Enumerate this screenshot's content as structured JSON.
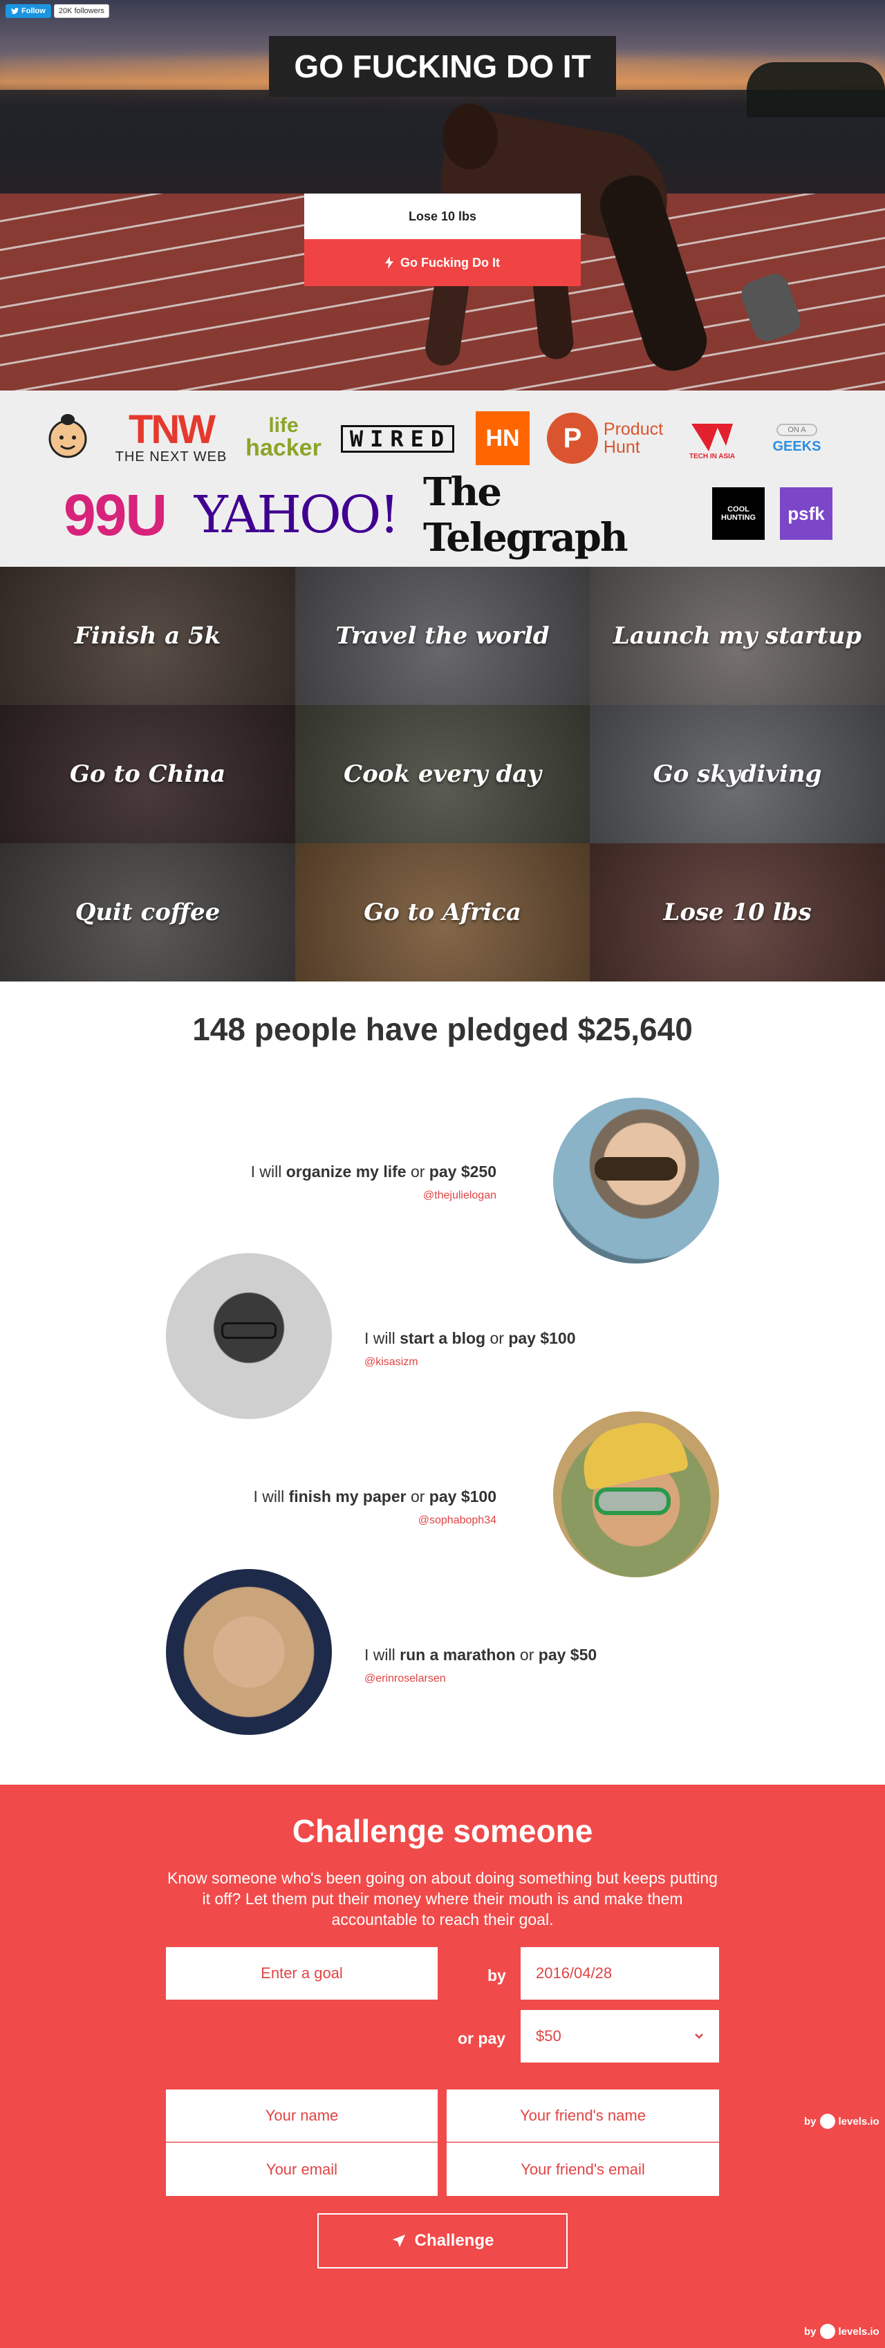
{
  "twitter": {
    "follow_label": "Follow",
    "followers": "20K followers"
  },
  "hero": {
    "title": "GO FUCKING DO IT",
    "goal": "Lose 10 lbs",
    "button": "Go Fucking Do It"
  },
  "press": {
    "tnw": "TNW",
    "tnw_sub": "THE NEXT WEB",
    "lifehacker_1": "life",
    "lifehacker_2": "hacker",
    "wired": "WIRED",
    "hn": "HN",
    "producthunt_p": "P",
    "producthunt_1": "Product",
    "producthunt_2": "Hunt",
    "techinasia": "TECH IN ASIA",
    "geeks_1": "GEEKS",
    "geeks_2": "ON A",
    "u99": "99U",
    "yahoo": "YAHOO!",
    "telegraph": "The Telegraph",
    "coolhunting": "COOL HUNTING",
    "psfk": "psfk"
  },
  "goals": [
    {
      "label": "Finish a 5k",
      "color": "#4a3d36"
    },
    {
      "label": "Travel the world",
      "color": "#5b5a5e"
    },
    {
      "label": "Launch my startup",
      "color": "#6a6562"
    },
    {
      "label": "Go to China",
      "color": "#3a2a2c"
    },
    {
      "label": "Cook every day",
      "color": "#4c4d42"
    },
    {
      "label": "Go skydiving",
      "color": "#5f6165"
    },
    {
      "label": "Quit coffee",
      "color": "#4c4a48"
    },
    {
      "label": "Go to Africa",
      "color": "#7a5a3a"
    },
    {
      "label": "Lose 10 lbs",
      "color": "#5a3a35"
    }
  ],
  "pledges": {
    "title": "148 people have pledged $25,640",
    "items": [
      {
        "pre": "I will ",
        "goal": "organize my life",
        "mid": " or ",
        "pay": "pay $250",
        "handle": "@thejulielogan"
      },
      {
        "pre": "I will ",
        "goal": "start a blog",
        "mid": " or ",
        "pay": "pay $100",
        "handle": "@kisasizm"
      },
      {
        "pre": "I will ",
        "goal": "finish my paper",
        "mid": " or ",
        "pay": "pay $100",
        "handle": "@sophaboph34"
      },
      {
        "pre": "I will ",
        "goal": "run a marathon",
        "mid": " or ",
        "pay": "pay $50",
        "handle": "@erinroselarsen"
      }
    ]
  },
  "challenge": {
    "title": "Challenge someone",
    "description": "Know someone who's been going on about doing something but keeps putting it off? Let them put their money where their mouth is and make them accountable to reach their goal.",
    "goal_placeholder": "Enter a goal",
    "by_label": "by",
    "date": "2016/04/28",
    "orpay_label": "or pay",
    "amount": "$50",
    "your_name": "Your name",
    "friend_name": "Your friend's name",
    "your_email": "Your email",
    "friend_email": "Your friend's email",
    "button": "Challenge"
  },
  "byline": {
    "by": "by",
    "brand": "levels.io"
  },
  "colors": {
    "accent": "#f14a4a",
    "dark": "#222222",
    "text": "#333333"
  }
}
